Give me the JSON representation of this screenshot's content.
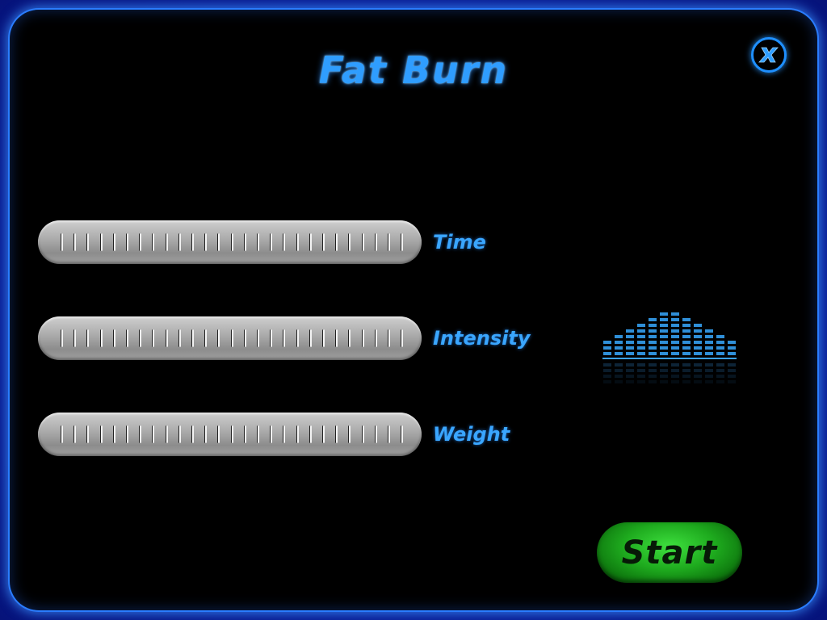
{
  "screen": {
    "title": "Fat Burn"
  },
  "controls": {
    "close_icon": "close-x-icon",
    "sliders": [
      {
        "label": "Time"
      },
      {
        "label": "Intensity"
      },
      {
        "label": "Weight"
      }
    ],
    "start_label": "Start"
  },
  "colors": {
    "accent": "#2f9dff",
    "frame": "#0a1f9e",
    "start_button": "#1eaa1e",
    "background": "#000000"
  },
  "profile_graph": {
    "icon": "equalizer-profile-icon",
    "levels": [
      3,
      4,
      5,
      6,
      7,
      8,
      8,
      7,
      6,
      5,
      4,
      3
    ]
  }
}
